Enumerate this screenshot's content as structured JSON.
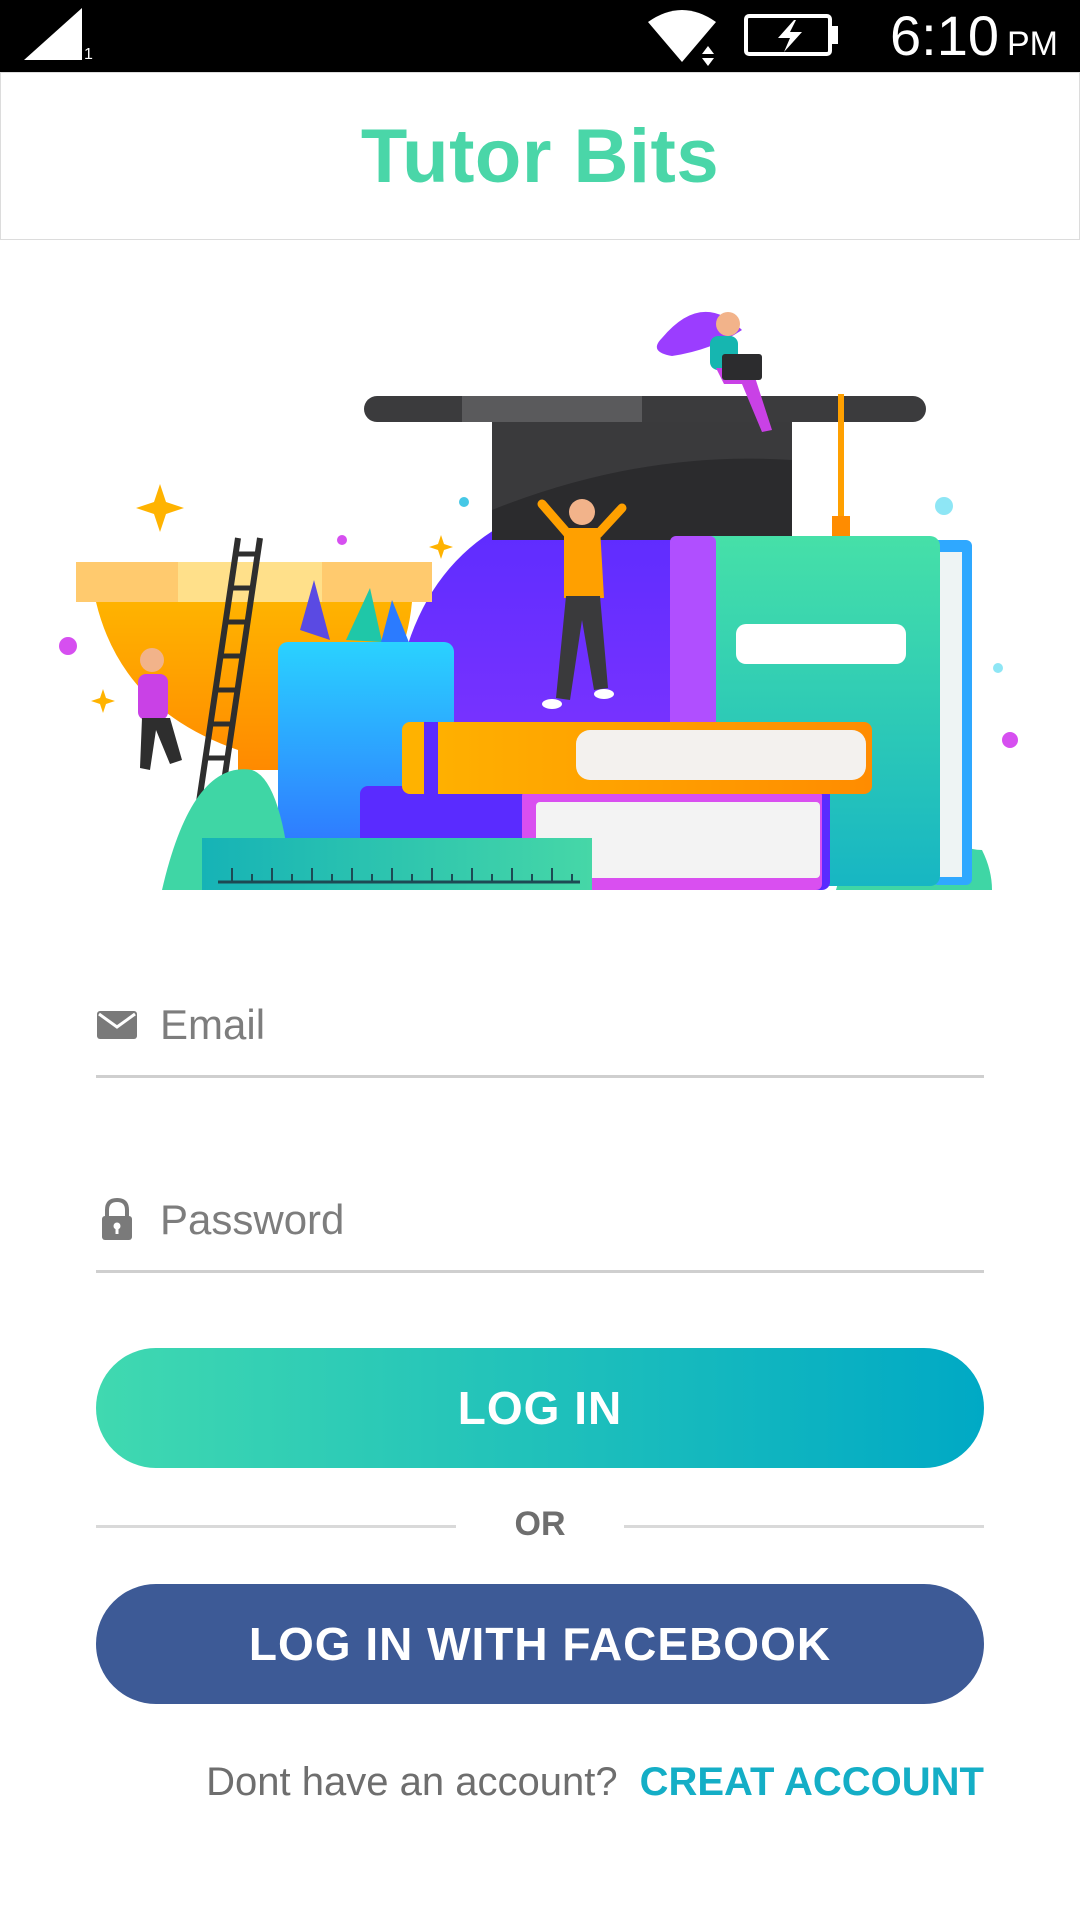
{
  "status_bar": {
    "signal_sub": "1",
    "time": "6:10",
    "ampm": "PM"
  },
  "app": {
    "title": "Tutor Bits"
  },
  "form": {
    "email_placeholder": "Email",
    "email_value": "",
    "password_placeholder": "Password",
    "password_value": ""
  },
  "actions": {
    "login_label": "LOG IN",
    "or_label": "OR",
    "facebook_label": "LOG IN WITH FACEBOOK"
  },
  "signup": {
    "prompt": "Dont have an account?",
    "link_label": "CREAT ACCOUNT"
  },
  "icons": {
    "email": "mail-icon",
    "password": "lock-icon"
  },
  "colors": {
    "title": "#4ad6a8",
    "login_gradient_start": "#40d9b0",
    "login_gradient_end": "#00a9c5",
    "facebook": "#3d5a96",
    "link": "#14aec6"
  }
}
